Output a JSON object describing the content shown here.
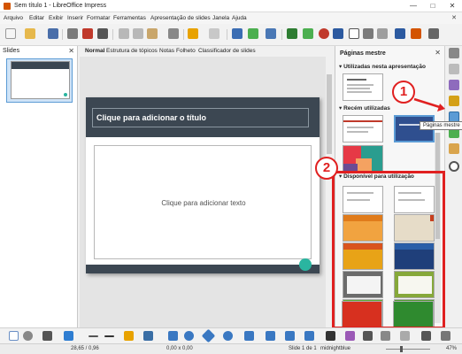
{
  "window": {
    "title": "Sem título 1 - LibreOffice Impress",
    "min_glyph": "—",
    "max_glyph": "□",
    "close_glyph": "✕"
  },
  "menu": {
    "items": [
      "Arquivo",
      "Editar",
      "Exibir",
      "Inserir",
      "Formatar",
      "Ferramentas",
      "Apresentação de slides",
      "Janela",
      "Ajuda"
    ],
    "close_glyph": "✕"
  },
  "slides_pane": {
    "title": "Slides",
    "close_glyph": "✕"
  },
  "view_tabs": [
    "Normal",
    "Estrutura de tópicos",
    "Notas",
    "Folheto",
    "Classificador de slides"
  ],
  "slide": {
    "title_placeholder": "Clique para adicionar o título",
    "content_placeholder": "Clique para adicionar texto"
  },
  "master_pages": {
    "title": "Páginas mestre",
    "close_glyph": "✕",
    "section_used": "Utilizadas nesta apresentação",
    "section_recent": "Recém utilizadas",
    "section_available": "Disponível para utilização",
    "tooltip": "Páginas mestre"
  },
  "annotations": {
    "one": "1",
    "two": "2"
  },
  "status": {
    "position": "28,65 / 0,96",
    "size": "0,00 x 0,00",
    "slide_counter": "Slide 1 de 1",
    "master_name": "midnightblue",
    "zoom": "47%"
  },
  "colors": {
    "slide_header": "#3c4752",
    "accent_teal": "#2ab5a0",
    "annotation_red": "#e02020",
    "selection_blue": "#5b9bd5"
  }
}
